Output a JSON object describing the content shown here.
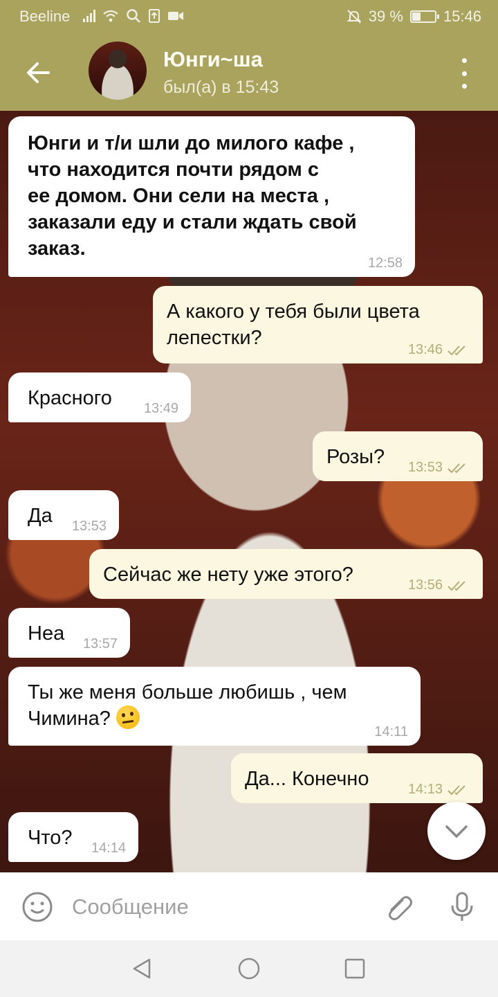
{
  "status_bar": {
    "carrier": "Beeline",
    "battery": "39 %",
    "battery_level": 0.39,
    "time": "15:46"
  },
  "header": {
    "title": "Юнги~ша",
    "subtitle": "был(а) в 15:43"
  },
  "messages": [
    {
      "dir": "in",
      "text": "Юнги и т/и шли до милого кафе ,\nчто находится почти рядом с\nее домом. Они сели на места ,\nзаказали еду и стали ждать свой\nзаказ.",
      "time": "12:58"
    },
    {
      "dir": "out",
      "text": "А какого у тебя были цвета\nлепестки?",
      "time": "13:46"
    },
    {
      "dir": "in",
      "text": "Красного",
      "time": "13:49"
    },
    {
      "dir": "out",
      "text": "Розы?",
      "time": "13:53"
    },
    {
      "dir": "in",
      "text": "Да",
      "time": "13:53"
    },
    {
      "dir": "out",
      "text": "Сейчас же нету уже этого?",
      "time": "13:56"
    },
    {
      "dir": "in",
      "text": "Неа",
      "time": "13:57"
    },
    {
      "dir": "in",
      "text": "Ты же меня больше любишь , чем\nЧимина?",
      "time": "14:11"
    },
    {
      "dir": "out",
      "text": "Да... Конечно",
      "time": "14:13"
    },
    {
      "dir": "in",
      "text": "Что?",
      "time": "14:14"
    }
  ],
  "input": {
    "placeholder": "Сообщение"
  },
  "icons": {
    "back": "arrow-left-icon",
    "menu": "more-vert-icon",
    "emoji": "smile-icon",
    "attach": "paperclip-icon",
    "mic": "microphone-icon",
    "scroll": "chevron-down-icon"
  }
}
